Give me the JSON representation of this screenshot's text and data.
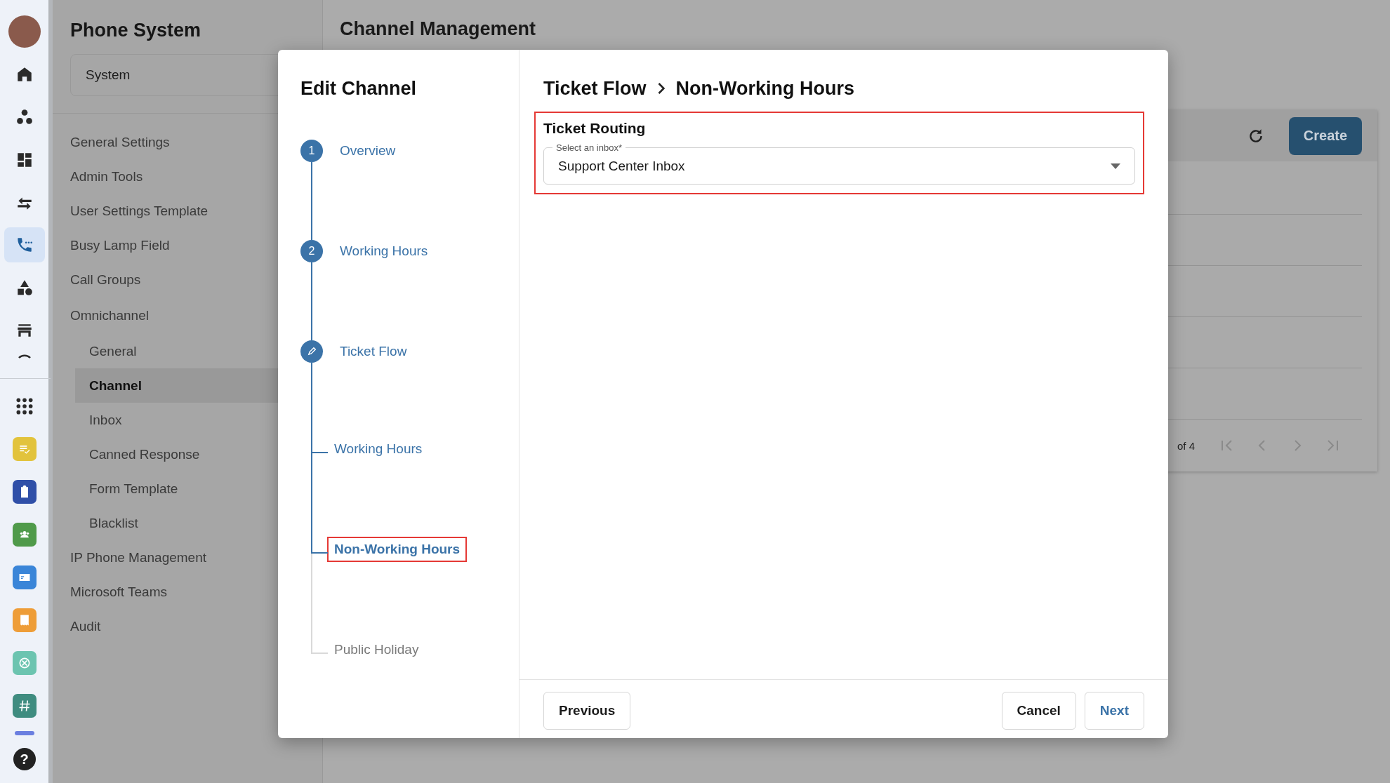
{
  "rail": {
    "items": [
      {
        "kind": "avatar",
        "selected": false
      },
      {
        "kind": "home",
        "selected": false
      },
      {
        "kind": "dots",
        "selected": false
      },
      {
        "kind": "dashboard",
        "selected": false
      },
      {
        "kind": "arrows",
        "selected": false
      },
      {
        "kind": "phone",
        "selected": true
      },
      {
        "kind": "shapes",
        "selected": false
      },
      {
        "kind": "store",
        "selected": false
      },
      {
        "kind": "arc",
        "selected": false
      },
      {
        "kind": "divider",
        "selected": false
      },
      {
        "kind": "grid",
        "selected": false
      },
      {
        "kind": "note",
        "selected": false,
        "color": "#e2c33c"
      },
      {
        "kind": "clipboard",
        "selected": false,
        "color": "#2f4fa8"
      },
      {
        "kind": "people",
        "selected": false,
        "color": "#4f9a4a"
      },
      {
        "kind": "card",
        "selected": false,
        "color": "#3a85d8"
      },
      {
        "kind": "receipt",
        "selected": false,
        "color": "#ee9d38"
      },
      {
        "kind": "compass",
        "selected": false,
        "color": "#6cc4b0"
      },
      {
        "kind": "hash",
        "selected": false,
        "color": "#3f8c80"
      },
      {
        "kind": "stub",
        "selected": false,
        "color": "#6b7fe0"
      }
    ],
    "help": "?"
  },
  "sidebar": {
    "title": "Phone System",
    "scope": "System",
    "items": [
      {
        "label": "General Settings",
        "selected": false
      },
      {
        "label": "Admin Tools",
        "selected": false
      },
      {
        "label": "User Settings Template",
        "selected": false
      },
      {
        "label": "Busy Lamp Field",
        "selected": false
      },
      {
        "label": "Call Groups",
        "selected": false
      },
      {
        "label": "Omnichannel",
        "selected": false,
        "children": [
          {
            "label": "General",
            "selected": false
          },
          {
            "label": "Channel",
            "selected": true
          },
          {
            "label": "Inbox",
            "selected": false
          },
          {
            "label": "Canned Response",
            "selected": false
          },
          {
            "label": "Form Template",
            "selected": false
          },
          {
            "label": "Blacklist",
            "selected": false
          }
        ]
      },
      {
        "label": "IP Phone Management",
        "selected": false
      },
      {
        "label": "Microsoft Teams",
        "selected": false
      },
      {
        "label": "Audit",
        "selected": false
      }
    ]
  },
  "main": {
    "title": "Channel Management",
    "create_button": "Create",
    "pagination": "of 4"
  },
  "dialog": {
    "title": "Edit Channel",
    "steps": [
      {
        "kind": "numbered",
        "number": "1",
        "label": "Overview"
      },
      {
        "kind": "numbered",
        "number": "2",
        "label": "Working Hours"
      },
      {
        "kind": "editing",
        "label": "Ticket Flow",
        "children": [
          {
            "label": "Working Hours",
            "visited": true,
            "selected": false,
            "highlighted": false
          },
          {
            "label": "Non-Working Hours",
            "visited": true,
            "selected": true,
            "highlighted": true
          },
          {
            "label": "Public Holiday",
            "visited": false,
            "selected": false,
            "highlighted": false
          }
        ]
      }
    ],
    "breadcrumb": [
      "Ticket Flow",
      "Non-Working Hours"
    ],
    "section": {
      "title": "Ticket Routing",
      "highlighted": true,
      "field": {
        "label": "Select an inbox*",
        "value": "Support Center Inbox"
      }
    },
    "buttons": {
      "previous": "Previous",
      "cancel": "Cancel",
      "next": "Next"
    }
  }
}
